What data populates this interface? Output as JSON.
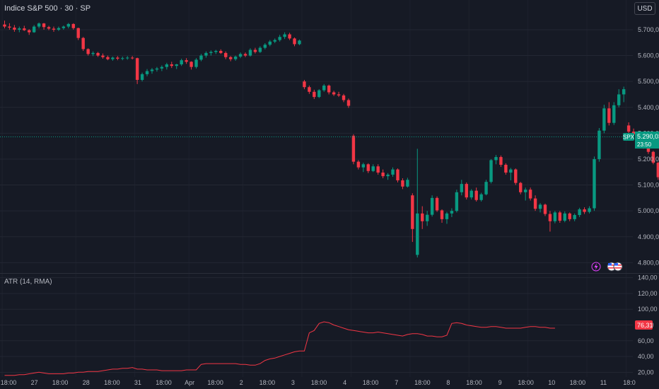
{
  "header": {
    "symbol_title": "Indice S&P 500 · 30 · SP",
    "currency_button": "USD"
  },
  "price_label": {
    "ticker": "SPX",
    "value": "5.290,03",
    "countdown": "23:50",
    "color": "#089981"
  },
  "indicator": {
    "title": "ATR (14, RMA)",
    "value_label": "76,31",
    "color": "#f23645"
  },
  "colors": {
    "background": "#161a25",
    "grid": "#232733",
    "up": "#089981",
    "down": "#f23645",
    "axis_text": "#b2b5be"
  },
  "event_icons": [
    "lightning-icon",
    "us-flag-icon",
    "us-flag-icon"
  ],
  "chart_data": [
    {
      "type": "candlestick",
      "title": "Indice S&P 500 · 30 · SP",
      "y_axis_ticks": [
        "5.700,00",
        "5.600,00",
        "5.500,00",
        "5.400,00",
        "5.300,00",
        "5.200,00",
        "5.100,00",
        "5.000,00",
        "4.900,00",
        "4.800,00"
      ],
      "ylim": [
        4760,
        5760
      ],
      "last_value": 5290.03,
      "sessions": [
        {
          "day": "27",
          "candles": [
            [
              5720,
              5735,
              5705,
              5712
            ],
            [
              5712,
              5725,
              5700,
              5708
            ],
            [
              5708,
              5718,
              5692,
              5700
            ],
            [
              5700,
              5712,
              5690,
              5705
            ],
            [
              5705,
              5715,
              5695,
              5698
            ],
            [
              5698,
              5702,
              5680,
              5690
            ],
            [
              5690,
              5718,
              5688,
              5712
            ],
            [
              5712,
              5728,
              5705,
              5724
            ],
            [
              5724,
              5726,
              5700,
              5710
            ],
            [
              5710,
              5715,
              5698,
              5704
            ],
            [
              5704,
              5712,
              5692,
              5700
            ],
            [
              5700,
              5712,
              5695,
              5706
            ],
            [
              5706,
              5716,
              5700,
              5712
            ],
            [
              5712,
              5726,
              5705,
              5722
            ],
            [
              5722,
              5725,
              5700,
              5706
            ]
          ]
        },
        {
          "day": "28",
          "candles": [
            [
              5706,
              5708,
              5660,
              5668
            ],
            [
              5668,
              5672,
              5618,
              5625
            ],
            [
              5625,
              5628,
              5600,
              5606
            ],
            [
              5606,
              5616,
              5598,
              5610
            ],
            [
              5610,
              5614,
              5595,
              5600
            ],
            [
              5600,
              5608,
              5588,
              5594
            ],
            [
              5594,
              5600,
              5582,
              5586
            ],
            [
              5586,
              5596,
              5580,
              5592
            ],
            [
              5592,
              5598,
              5582,
              5588
            ],
            [
              5588,
              5596,
              5582,
              5590
            ],
            [
              5590,
              5598,
              5584,
              5592
            ],
            [
              5592,
              5598,
              5585,
              5590
            ]
          ]
        },
        {
          "day": "31",
          "candles": [
            [
              5590,
              5592,
              5490,
              5506
            ],
            [
              5506,
              5534,
              5500,
              5528
            ],
            [
              5528,
              5548,
              5520,
              5540
            ],
            [
              5540,
              5552,
              5530,
              5546
            ],
            [
              5546,
              5556,
              5538,
              5550
            ],
            [
              5550,
              5562,
              5540,
              5556
            ],
            [
              5556,
              5572,
              5546,
              5566
            ],
            [
              5566,
              5576,
              5552,
              5560
            ],
            [
              5560,
              5568,
              5548,
              5566
            ],
            [
              5566,
              5588,
              5560,
              5582
            ],
            [
              5582,
              5590,
              5568,
              5576
            ]
          ]
        },
        {
          "day": "Apr",
          "candles": [
            [
              5576,
              5578,
              5546,
              5556
            ],
            [
              5556,
              5590,
              5550,
              5584
            ],
            [
              5584,
              5606,
              5578,
              5600
            ],
            [
              5600,
              5616,
              5592,
              5610
            ],
            [
              5610,
              5620,
              5600,
              5614
            ],
            [
              5614,
              5622,
              5606,
              5618
            ],
            [
              5618,
              5624,
              5606,
              5610
            ],
            [
              5610,
              5616,
              5586,
              5594
            ],
            [
              5594,
              5598,
              5578,
              5586
            ],
            [
              5586,
              5600,
              5580,
              5596
            ],
            [
              5596,
              5612,
              5590,
              5606
            ]
          ]
        },
        {
          "day": "2",
          "candles": [
            [
              5606,
              5612,
              5594,
              5600
            ],
            [
              5600,
              5628,
              5596,
              5622
            ],
            [
              5622,
              5630,
              5608,
              5614
            ],
            [
              5614,
              5636,
              5610,
              5630
            ],
            [
              5630,
              5648,
              5624,
              5642
            ],
            [
              5642,
              5660,
              5636,
              5654
            ],
            [
              5654,
              5666,
              5648,
              5660
            ],
            [
              5660,
              5680,
              5654,
              5672
            ],
            [
              5672,
              5690,
              5664,
              5682
            ],
            [
              5682,
              5688,
              5660,
              5666
            ],
            [
              5666,
              5670,
              5636,
              5644
            ],
            [
              5644,
              5662,
              5640,
              5658
            ]
          ]
        },
        {
          "day": "3",
          "candles": [
            [
              5500,
              5506,
              5470,
              5478
            ],
            [
              5478,
              5484,
              5452,
              5460
            ],
            [
              5460,
              5468,
              5432,
              5440
            ],
            [
              5440,
              5470,
              5436,
              5466
            ],
            [
              5466,
              5490,
              5460,
              5484
            ],
            [
              5484,
              5488,
              5450,
              5458
            ],
            [
              5458,
              5464,
              5444,
              5450
            ],
            [
              5450,
              5460,
              5440,
              5446
            ],
            [
              5446,
              5452,
              5420,
              5428
            ],
            [
              5428,
              5434,
              5398,
              5406
            ]
          ]
        },
        {
          "day": "4",
          "candles": [
            [
              5290,
              5296,
              5180,
              5190
            ],
            [
              5190,
              5196,
              5160,
              5168
            ],
            [
              5168,
              5186,
              5150,
              5180
            ],
            [
              5180,
              5184,
              5146,
              5154
            ],
            [
              5154,
              5180,
              5150,
              5172
            ],
            [
              5172,
              5180,
              5140,
              5148
            ],
            [
              5148,
              5160,
              5126,
              5134
            ],
            [
              5134,
              5146,
              5120,
              5140
            ],
            [
              5140,
              5168,
              5132,
              5160
            ],
            [
              5160,
              5164,
              5110,
              5118
            ],
            [
              5118,
              5126,
              5084,
              5094
            ],
            [
              5094,
              5128,
              5090,
              5120
            ]
          ]
        },
        {
          "day": "7",
          "candles": [
            [
              5060,
              5068,
              4880,
              4930
            ],
            [
              4830,
              5240,
              4820,
              4990
            ],
            [
              4990,
              5018,
              4930,
              4960
            ],
            [
              4960,
              5000,
              4942,
              4985
            ],
            [
              4985,
              5060,
              4978,
              5050
            ],
            [
              5050,
              5056,
              4996,
              5002
            ],
            [
              5002,
              5006,
              4954,
              4968
            ],
            [
              4968,
              4996,
              4950,
              4990
            ],
            [
              4990,
              5010,
              4976,
              5000
            ],
            [
              5000,
              5082,
              4994,
              5072
            ],
            [
              5072,
              5120,
              5060,
              5104
            ],
            [
              5104,
              5110,
              5044,
              5052
            ]
          ]
        },
        {
          "day": "8",
          "candles": [
            [
              5052,
              5084,
              5044,
              5078
            ],
            [
              5078,
              5090,
              5036,
              5042
            ],
            [
              5042,
              5070,
              5036,
              5064
            ],
            [
              5064,
              5120,
              5060,
              5112
            ],
            [
              5112,
              5200,
              5106,
              5196
            ],
            [
              5196,
              5216,
              5180,
              5208
            ],
            [
              5208,
              5214,
              5170,
              5178
            ],
            [
              5178,
              5184,
              5140,
              5148
            ],
            [
              5148,
              5166,
              5118,
              5160
            ],
            [
              5160,
              5164,
              5100,
              5108
            ],
            [
              5108,
              5112,
              5064,
              5072
            ],
            [
              5072,
              5090,
              5040,
              5082
            ]
          ]
        },
        {
          "day": "9",
          "candles": [
            [
              5082,
              5090,
              5040,
              5048
            ],
            [
              5048,
              5060,
              5000,
              5008
            ],
            [
              5008,
              5030,
              4994,
              5024
            ],
            [
              5024,
              5028,
              4980,
              4988
            ],
            [
              4988,
              5000,
              4920,
              4960
            ],
            [
              4960,
              5000,
              4952,
              4994
            ],
            [
              4994,
              5000,
              4954,
              4962
            ],
            [
              4962,
              4998,
              4956,
              4990
            ],
            [
              4990,
              4994,
              4960,
              4968
            ],
            [
              4968,
              4990,
              4960,
              4984
            ],
            [
              4984,
              5012,
              4976,
              5006
            ],
            [
              5006,
              5014,
              4988,
              4996
            ]
          ]
        },
        {
          "day": "10",
          "candles": [
            [
              4996,
              5018,
              4990,
              5010
            ],
            [
              5010,
              5210,
              5000,
              5200
            ],
            [
              5200,
              5320,
              5190,
              5310
            ],
            [
              5310,
              5410,
              5300,
              5396
            ],
            [
              5396,
              5420,
              5330,
              5340
            ],
            [
              5340,
              5420,
              5332,
              5408
            ],
            [
              5408,
              5470,
              5400,
              5450
            ],
            [
              5450,
              5480,
              5420,
              5470
            ]
          ]
        },
        {
          "day": "11",
          "candles": [
            [
              5330,
              5342,
              5296,
              5306
            ],
            [
              5306,
              5318,
              5286,
              5296
            ],
            [
              5296,
              5302,
              5268,
              5276
            ],
            [
              5276,
              5286,
              5240,
              5250
            ],
            [
              5250,
              5256,
              5220,
              5228
            ],
            [
              5228,
              5232,
              5180,
              5186
            ],
            [
              5186,
              5190,
              5120,
              5130
            ],
            [
              5130,
              5186,
              5124,
              5180
            ],
            [
              5180,
              5222,
              5172,
              5216
            ],
            [
              5216,
              5260,
              5210,
              5254
            ],
            [
              5254,
              5296,
              5248,
              5290
            ]
          ]
        }
      ],
      "gaps_after_day": [
        "2",
        "3",
        "4",
        "10"
      ]
    },
    {
      "type": "line",
      "title": "ATR (14, RMA)",
      "y_axis_ticks": [
        "140,00",
        "120,00",
        "100,00",
        "80,00",
        "60,00",
        "40,00",
        "20,00"
      ],
      "ylim": [
        14,
        146
      ],
      "last_value": 76.31,
      "series": [
        {
          "values": [
            16,
            16,
            16,
            17,
            17,
            18,
            19,
            20,
            19,
            18,
            18,
            18,
            18,
            19,
            19,
            20,
            20,
            21,
            21,
            21,
            22,
            23,
            24,
            24,
            25,
            25,
            26,
            24,
            24,
            23,
            23,
            23,
            22,
            22,
            22,
            22,
            22,
            23,
            23,
            23,
            30,
            31,
            31,
            31,
            31,
            31,
            31,
            31,
            30,
            30,
            29,
            29,
            31,
            35,
            37,
            38,
            40,
            42,
            44,
            46,
            47,
            47,
            70,
            73,
            82,
            84,
            83,
            80,
            78,
            76,
            74,
            73,
            72,
            71,
            70,
            70,
            71,
            70,
            69,
            68,
            67,
            66,
            68,
            69,
            69,
            68,
            66,
            66,
            65,
            65,
            67,
            82,
            83,
            82,
            80,
            79,
            78,
            77,
            77,
            78,
            78,
            77,
            76,
            76,
            76,
            76,
            77,
            78,
            78,
            77,
            77,
            76,
            76
          ]
        }
      ]
    }
  ],
  "x_axis": {
    "labels": [
      "18:00",
      "27",
      "18:00",
      "28",
      "18:00",
      "31",
      "18:00",
      "Apr",
      "18:00",
      "2",
      "18:00",
      "3",
      "18:00",
      "4",
      "18:00",
      "7",
      "18:00",
      "8",
      "18:00",
      "9",
      "18:00",
      "10",
      "18:00",
      "11",
      "18:0"
    ]
  }
}
